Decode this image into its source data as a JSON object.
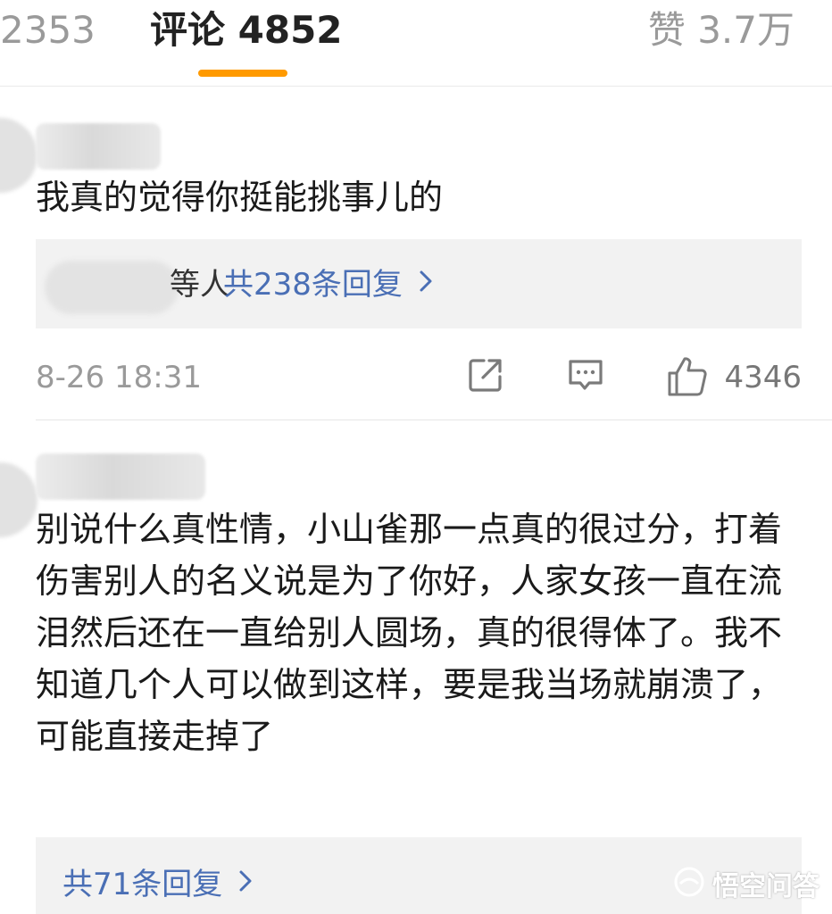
{
  "tabs": {
    "reposts_count": "2353",
    "comments_label": "评论 4852",
    "likes_label": "赞 3.7万"
  },
  "comments": [
    {
      "text": "我真的觉得你挺能挑事儿的",
      "reply_suffix": "等人",
      "reply_link": "共238条回复",
      "time": "8-26 18:31",
      "likes": "4346"
    },
    {
      "text": "别说什么真性情，小山雀那一点真的很过分，打着伤害别人的名义说是为了你好，人家女孩一直在流泪然后还在一直给别人圆场，真的很得体了。我不知道几个人可以做到这样，要是我当场就崩溃了，可能直接走掉了",
      "reply_link": "共71条回复"
    }
  ],
  "icons": {
    "share": "share-icon",
    "comment": "comment-icon",
    "like": "thumbs-up-icon"
  },
  "watermark": {
    "text": "悟空问答"
  },
  "colors": {
    "accent_underline": "#ff9a00",
    "reply_link": "#4a6fb5",
    "muted": "#9a9a9a"
  }
}
